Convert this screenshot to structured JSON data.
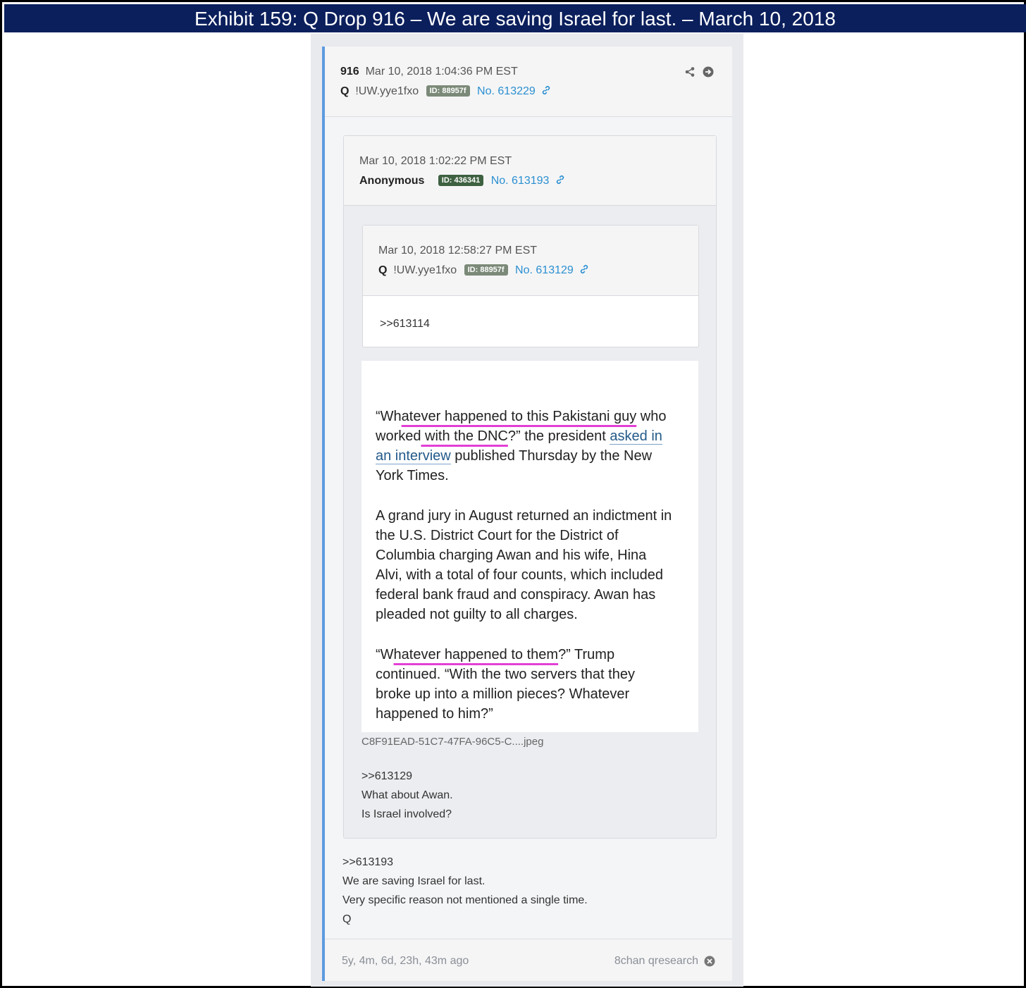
{
  "banner": {
    "title": "Exhibit 159: Q Drop 916 – We are saving Israel for last. – March 10, 2018"
  },
  "drop": {
    "number": "916",
    "timestamp": "Mar 10, 2018 1:04:36 PM EST",
    "author": "Q",
    "tripcode": "!UW.yye1fxo",
    "id_badge": "ID: 88957f",
    "post_no": "No. 613229",
    "icons": [
      "share-icon",
      "arrow-right-circle-icon",
      "link-icon"
    ]
  },
  "reply1": {
    "timestamp": "Mar 10, 2018 1:02:22 PM EST",
    "author": "Anonymous",
    "id_badge": "ID: 436341",
    "post_no": "No. 613193"
  },
  "reply2": {
    "timestamp": "Mar 10, 2018 12:58:27 PM EST",
    "author": "Q",
    "tripcode": "!UW.yye1fxo",
    "id_badge": "ID: 88957f",
    "post_no": "No. 613129",
    "body": ">>613114"
  },
  "article": {
    "p1_a": "“Wh",
    "p1_hl1": "atever happened to this Pakistani guy",
    "p1_b": " who",
    "p1_c": "worked",
    "p1_hl2": " with the DNC",
    "p1_d": "?” the president ",
    "p1_link1": "asked in",
    "p1_link2": "an interview",
    "p1_e": " published Thursday by the New",
    "p1_f": "York Times.",
    "p2_l1": "A grand jury in August returned an indictment in",
    "p2_l2": "the U.S. District Court for the District of",
    "p2_l3": "Columbia charging Awan and his wife, Hina",
    "p2_l4": "Alvi, with a total of four counts, which included",
    "p2_l5": "federal bank fraud and conspiracy. Awan has",
    "p2_l6": "pleaded not guilty to all charges.",
    "p3_a": "“W",
    "p3_hl": "hatever happened to them",
    "p3_b": "?” Trump",
    "p3_l2": "continued. “With the two servers that they",
    "p3_l3": "broke up into a million pieces? Whatever",
    "p3_l4": "happened to him?”"
  },
  "reply1_image_filename": "C8F91EAD-51C7-47FA-96C5-C....jpeg",
  "reply1_body": [
    ">>613129",
    "What about Awan.",
    "Is Israel involved?"
  ],
  "drop_body": [
    ">>613193",
    "We are saving Israel for last.",
    "Very specific reason not mentioned a single time.",
    "Q"
  ],
  "footer": {
    "age": "5y, 4m, 6d, 23h, 43m ago",
    "source": "8chan qresearch"
  },
  "colors": {
    "banner": "#0b1f5c",
    "accent_border": "#5d9be0",
    "link": "#2a8fd0",
    "highlight": "#e23fd5"
  }
}
